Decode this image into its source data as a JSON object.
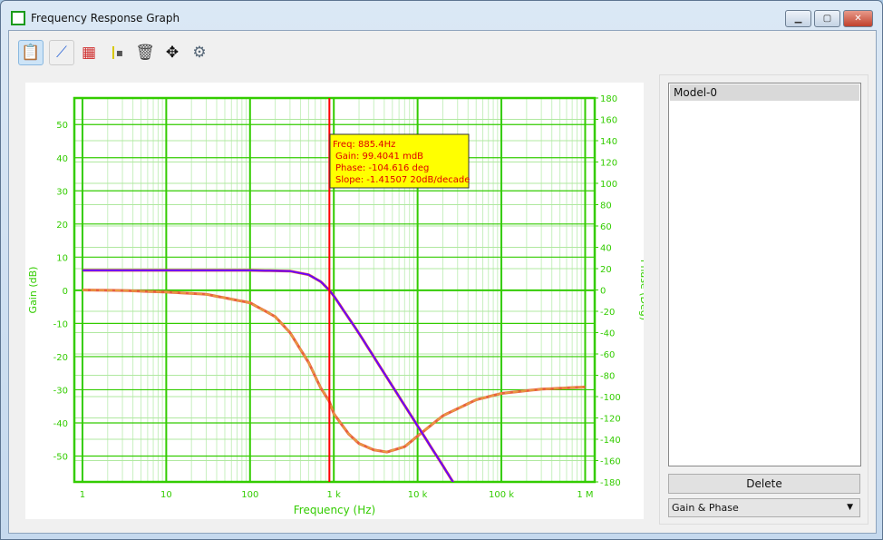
{
  "window": {
    "title": "Frequency Response Graph",
    "icon": "bode-plot-icon",
    "controls": [
      "minimize",
      "maximize",
      "close"
    ]
  },
  "toolbar": {
    "icons": [
      "clipboard-list-icon",
      "line-chart-icon",
      "chart-overlay-icon",
      "marker-icon",
      "trash-icon",
      "move-arrows-icon",
      "settings-gear-icon"
    ]
  },
  "side": {
    "models": [
      "Model-0"
    ],
    "delete_label": "Delete",
    "view_select": "Gain & Phase"
  },
  "tooltip": {
    "freq": "Freq: 885.4Hz",
    "gain": "Gain: 99.4041 mdB",
    "phase": "Phase: -104.616 deg",
    "slope": "Slope: -1.41507 20dB/decade"
  },
  "colors": {
    "axis": "#33cc00",
    "grid_minor": "#c8f0c0",
    "cursor": "#ff0000",
    "gain": "#6a00ff",
    "phase": "#e87830",
    "tooltip_bg": "#ffff00"
  },
  "chart_data": {
    "type": "line",
    "xlabel": "Frequency (Hz)",
    "ylabel": "Gain (dB)",
    "y2label": "Phase (Deg)",
    "xscale": "log",
    "xlim": [
      0.8,
      1300000
    ],
    "ylim": [
      -57.8,
      58
    ],
    "y2lim": [
      -180,
      180
    ],
    "xticks": [
      1,
      10,
      100,
      1000,
      10000,
      100000,
      1000000
    ],
    "xtick_labels": [
      "1",
      "10",
      "100",
      "1 k",
      "10 k",
      "100 k",
      "1 M"
    ],
    "yticks": [
      50,
      40,
      30,
      20,
      10,
      0,
      -10,
      -20,
      -30,
      -40,
      -50
    ],
    "y2ticks": [
      180,
      160,
      140,
      120,
      100,
      80,
      60,
      40,
      20,
      0,
      -20,
      -40,
      -60,
      -80,
      -100,
      -120,
      -140,
      -160,
      -180
    ],
    "grid": true,
    "cursor_x": 885.4,
    "series": [
      {
        "axis": "left",
        "x": [
          1,
          10,
          100,
          300,
          500,
          700,
          885,
          1000,
          2000,
          5000,
          10000,
          20000,
          30000
        ],
        "y": [
          6,
          6,
          6,
          5.8,
          4.7,
          2.6,
          0,
          -1.7,
          -13,
          -28.9,
          -40.9,
          -52.9,
          -60
        ]
      },
      {
        "axis": "right",
        "x": [
          1,
          3,
          10,
          30,
          100,
          200,
          300,
          500,
          700,
          885,
          1000,
          1500,
          2000,
          3000,
          4300,
          7000,
          10000,
          20000,
          50000,
          100000,
          300000,
          1000000
        ],
        "y": [
          0,
          -0.5,
          -2,
          -4,
          -12,
          -25,
          -40,
          -68,
          -92,
          -104.6,
          -116,
          -135,
          -144,
          -150,
          -152,
          -147,
          -137,
          -118,
          -103,
          -97,
          -93,
          -91
        ]
      }
    ]
  }
}
